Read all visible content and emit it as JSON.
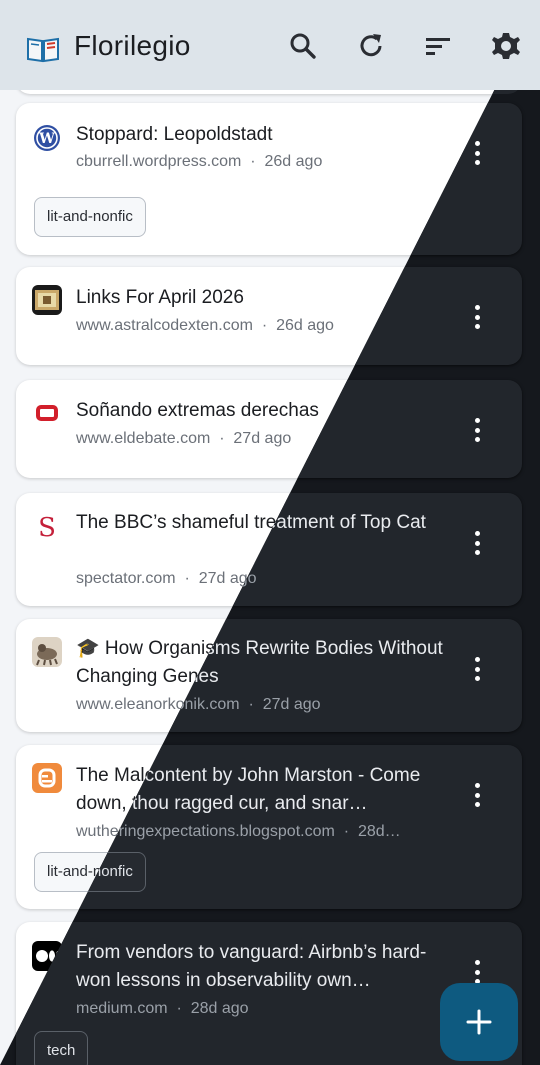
{
  "app": {
    "title": "Florilegio"
  },
  "toolbar": {
    "icons": [
      "search-icon",
      "refresh-icon",
      "sort-icon",
      "settings-icon"
    ]
  },
  "items": [
    {
      "title": "Stoppard: Leopoldstadt",
      "source": "cburrell.wordpress.com",
      "age": "26d ago",
      "tag": "lit-and-nonfic",
      "favicon": "wordpress-icon"
    },
    {
      "title": "Links For April 2026",
      "source": "www.astralcodexten.com",
      "age": "26d ago",
      "favicon": "astral-codex-icon"
    },
    {
      "title": "Soñando extremas derechas",
      "source": "www.eldebate.com",
      "age": "27d ago",
      "favicon": "eldebate-icon"
    },
    {
      "title": "The BBC’s shameful treatment of Top Cat",
      "source": "spectator.com",
      "age": "27d ago",
      "favicon": "spectator-icon"
    },
    {
      "title": "🎓 How Organisms Rewrite Bodies Without Changing Genes",
      "source": "www.eleanorkonik.com",
      "age": "27d ago",
      "favicon": "eleanorkonik-icon"
    },
    {
      "title": "The Malcontent by John Marston - Come down, thou ragged cur, and snar…",
      "source": "wutheringexpectations.blogspot.com",
      "age": "28d…",
      "tag": "lit-and-nonfic",
      "favicon": "blogger-icon"
    },
    {
      "title": "From vendors to vanguard: Airbnb’s hard-won lessons in observability own…",
      "source": "medium.com",
      "age": "28d ago",
      "tag": "tech",
      "favicon": "medium-icon"
    }
  ],
  "meta_separator": "·",
  "fab": {
    "icon": "plus-icon",
    "label": "+"
  }
}
